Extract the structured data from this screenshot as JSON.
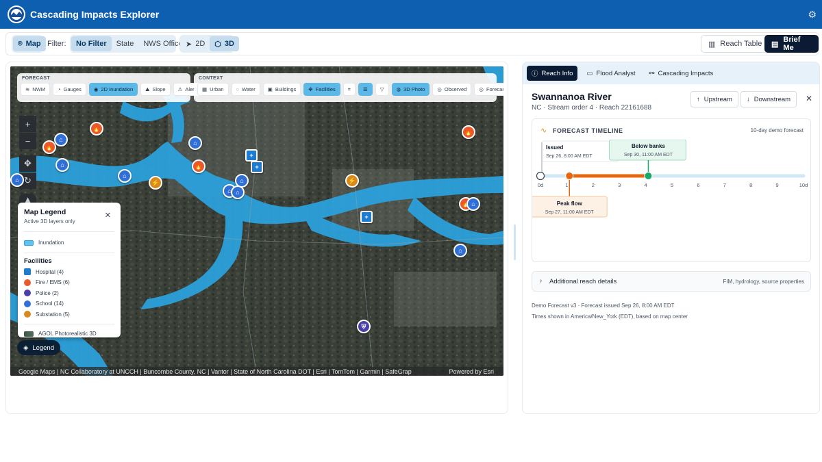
{
  "app": {
    "title": "Cascading Impacts Explorer"
  },
  "toolbar": {
    "map_label": "Map",
    "filter_label": "Filter:",
    "filters": [
      "No Filter",
      "State",
      "NWS Office"
    ],
    "view_2d": "2D",
    "view_3d": "3D",
    "reach_table": "Reach Table",
    "brief_me": "Brief Me"
  },
  "map": {
    "forecast": {
      "heading": "FORECAST",
      "buttons": [
        "NWM",
        "Gauges",
        "2D Inundation",
        "Slope",
        "Alerts"
      ]
    },
    "context": {
      "heading": "CONTEXT",
      "buttons": [
        "Urban",
        "Water",
        "Buildings",
        "Facilities",
        "3D Photo",
        "Observed",
        "Forecast"
      ]
    },
    "legend": {
      "title": "Map Legend",
      "subtitle": "Active 3D layers only",
      "inundation": "Inundation",
      "facilities_heading": "Facilities",
      "items": [
        {
          "label": "Hospital (4)",
          "color": "#1f7bd0"
        },
        {
          "label": "Fire / EMS (6)",
          "color": "#e8592c"
        },
        {
          "label": "Police (2)",
          "color": "#4b3fa8"
        },
        {
          "label": "School (14)",
          "color": "#2f6fd6"
        },
        {
          "label": "Substation (5)",
          "color": "#d98a1c"
        }
      ],
      "basemap": "AGOL Photorealistic 3D"
    },
    "legend_button": "Legend",
    "attribution": "Google Maps | NC Collaboratory at UNCCH | Buncombe County, NC | Vantor | State of North Carolina DOT | Esri | TomTom | Garmin | SafeGrap",
    "powered_by": "Powered by Esri"
  },
  "panel": {
    "tabs": [
      "Reach Info",
      "Flood Analyst",
      "Cascading Impacts"
    ],
    "river_name": "Swannanoa River",
    "river_sub": "NC · Stream order 4 · Reach 22161688",
    "upstream": "Upstream",
    "downstream": "Downstream",
    "timeline": {
      "title": "FORECAST TIMELINE",
      "demo": "10-day demo forecast",
      "issued_title": "Issued",
      "issued_time": "Sep 26, 8:00 AM EDT",
      "below_title": "Below banks",
      "below_time": "Sep 30, 11:00 AM EDT",
      "peak_title": "Peak flow",
      "peak_time": "Sep 27, 11:00 AM EDT",
      "ticks": [
        "0d",
        "1",
        "2",
        "3",
        "4",
        "5",
        "6",
        "7",
        "8",
        "9",
        "10d"
      ],
      "issued_day": 0,
      "peak_day": 1.1,
      "below_day": 4.1
    },
    "details_title": "Additional reach details",
    "details_right": "FIM, hydrology, source properties",
    "footer1": "Demo Forecast v3 · Forecast issued Sep 26, 8:00 AM EDT",
    "footer2": "Times shown in America/New_York (EDT), based on map center"
  },
  "colors": {
    "brand": "#0f5fb0",
    "inundation": "#2ba3e0",
    "fire": "#e8592c",
    "school": "#2f6fd6",
    "substation": "#d98a1c",
    "police": "#4b3fa8",
    "hospital": "#1f7bd0",
    "peak": "#e8650f",
    "below": "#1aa86a"
  }
}
